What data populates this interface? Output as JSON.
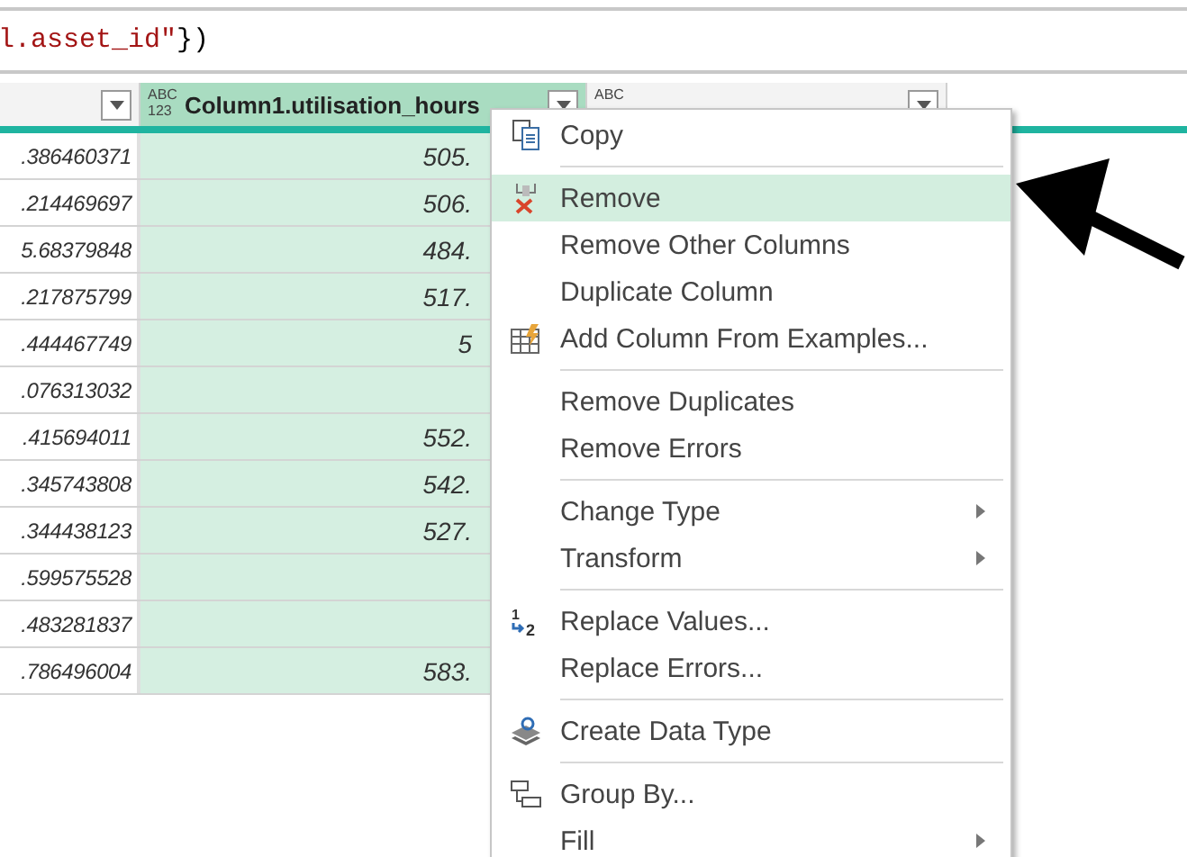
{
  "formula_bar": {
    "parts": [
      {
        "kind": "string",
        "text": "l.asset_id\""
      },
      {
        "kind": "plain",
        "text": "})"
      }
    ]
  },
  "table": {
    "columns": [
      {
        "selected": false
      },
      {
        "name": "Column1.utilisation_hours",
        "type_label": [
          "ABC",
          "123"
        ],
        "selected": true
      },
      {
        "type_label": [
          "ABC"
        ],
        "selected": false
      }
    ],
    "rows": [
      [
        ".386460371",
        "505."
      ],
      [
        ".214469697",
        "506."
      ],
      [
        "5.68379848",
        "484."
      ],
      [
        ".217875799",
        "517."
      ],
      [
        ".444467749",
        "5"
      ],
      [
        ".076313032",
        ""
      ],
      [
        ".415694011",
        "552."
      ],
      [
        ".345743808",
        "542."
      ],
      [
        ".344438123",
        "527."
      ],
      [
        ".599575528",
        ""
      ],
      [
        ".483281837",
        ""
      ],
      [
        ".786496004",
        "583."
      ]
    ]
  },
  "context_menu": {
    "items": [
      {
        "kind": "item",
        "label": "Copy",
        "selected": false,
        "submenu": false
      },
      {
        "kind": "separator"
      },
      {
        "kind": "item",
        "label": "Remove",
        "selected": true,
        "submenu": false
      },
      {
        "kind": "item",
        "label": "Remove Other Columns",
        "selected": false,
        "submenu": false
      },
      {
        "kind": "item",
        "label": "Duplicate Column",
        "selected": false,
        "submenu": false
      },
      {
        "kind": "item",
        "label": "Add Column From Examples...",
        "selected": false,
        "submenu": false
      },
      {
        "kind": "separator"
      },
      {
        "kind": "item",
        "label": "Remove Duplicates",
        "selected": false,
        "submenu": false
      },
      {
        "kind": "item",
        "label": "Remove Errors",
        "selected": false,
        "submenu": false
      },
      {
        "kind": "separator"
      },
      {
        "kind": "item",
        "label": "Change Type",
        "selected": false,
        "submenu": true
      },
      {
        "kind": "item",
        "label": "Transform",
        "selected": false,
        "submenu": true
      },
      {
        "kind": "separator"
      },
      {
        "kind": "item",
        "label": "Replace Values...",
        "selected": false,
        "submenu": false,
        "icon_glyphs": [
          "1",
          "2"
        ]
      },
      {
        "kind": "item",
        "label": "Replace Errors...",
        "selected": false,
        "submenu": false
      },
      {
        "kind": "separator"
      },
      {
        "kind": "item",
        "label": "Create Data Type",
        "selected": false,
        "submenu": false
      },
      {
        "kind": "separator"
      },
      {
        "kind": "item",
        "label": "Group By...",
        "selected": false,
        "submenu": false
      },
      {
        "kind": "item",
        "label": "Fill",
        "selected": false,
        "submenu": true
      }
    ]
  }
}
